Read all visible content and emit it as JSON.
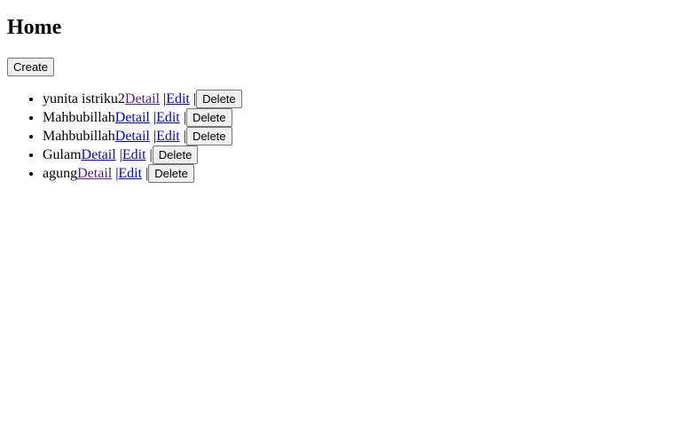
{
  "page": {
    "title": "Home",
    "create_label": "Create"
  },
  "items": [
    {
      "name": "yunita istriku2",
      "detail": "Detail",
      "detail_visited": true,
      "sep1": " |",
      "edit": "Edit",
      "sep2": " |",
      "delete": "Delete"
    },
    {
      "name": "Mahbubillah",
      "detail": "Detail",
      "detail_visited": false,
      "sep1": " |",
      "edit": "Edit",
      "sep2": " |",
      "delete": "Delete"
    },
    {
      "name": "Mahbubillah",
      "detail": "Detail",
      "detail_visited": false,
      "sep1": " |",
      "edit": "Edit",
      "sep2": " |",
      "delete": "Delete"
    },
    {
      "name": "Gulam",
      "detail": "Detail",
      "detail_visited": false,
      "sep1": " |",
      "edit": "Edit",
      "sep2": " |",
      "delete": "Delete"
    },
    {
      "name": "agung",
      "detail": "Detail",
      "detail_visited": true,
      "sep1": " |",
      "edit": "Edit",
      "sep2": " |",
      "delete": "Delete"
    }
  ],
  "colors": {
    "link": "#0000ee",
    "link_visited": "#551a8b"
  }
}
